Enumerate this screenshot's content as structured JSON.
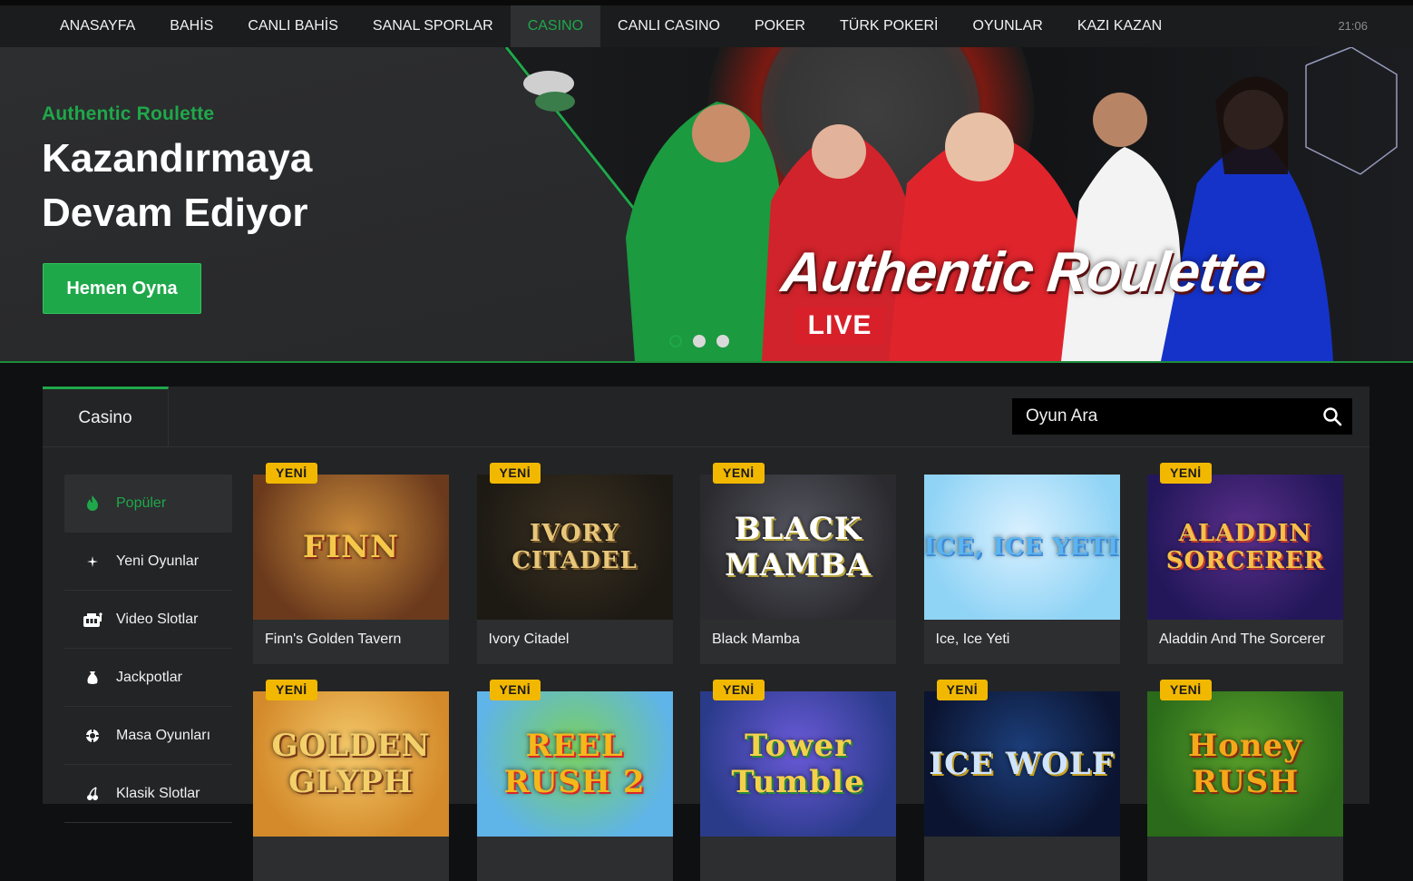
{
  "nav": {
    "items": [
      {
        "label": "ANASAYFA",
        "active": false
      },
      {
        "label": "BAHİS",
        "active": false
      },
      {
        "label": "CANLI BAHİS",
        "active": false
      },
      {
        "label": "SANAL SPORLAR",
        "active": false
      },
      {
        "label": "CASINO",
        "active": true
      },
      {
        "label": "CANLI CASINO",
        "active": false
      },
      {
        "label": "POKER",
        "active": false
      },
      {
        "label": "TÜRK POKERİ",
        "active": false
      },
      {
        "label": "OYUNLAR",
        "active": false
      },
      {
        "label": "KAZI KAZAN",
        "active": false
      }
    ],
    "clock": "21:06"
  },
  "hero": {
    "subtitle": "Authentic Roulette",
    "title": "Kazandırmaya Devam Ediyor",
    "cta": "Hemen Oyna",
    "overlay_title": "Authentic Roulette",
    "overlay_badge": "LIVE",
    "slides": 3,
    "active_slide": 0
  },
  "panel": {
    "tab_label": "Casino",
    "search_placeholder": "Oyun Ara"
  },
  "sidebar": {
    "items": [
      {
        "label": "Popüler",
        "icon": "flame-icon",
        "active": true
      },
      {
        "label": "Yeni Oyunlar",
        "icon": "sparkle-icon",
        "active": false
      },
      {
        "label": "Video Slotlar",
        "icon": "slot-machine-icon",
        "active": false
      },
      {
        "label": "Jackpotlar",
        "icon": "money-bag-icon",
        "active": false
      },
      {
        "label": "Masa Oyunları",
        "icon": "chip-icon",
        "active": false
      },
      {
        "label": "Klasik Slotlar",
        "icon": "cherry-icon",
        "active": false
      }
    ]
  },
  "games": {
    "badge_label": "YENİ",
    "rows": [
      [
        {
          "name": "Finn's Golden Tavern",
          "logo": "FINN",
          "new": true
        },
        {
          "name": "Ivory Citadel",
          "logo": "IVORY CITADEL",
          "new": true
        },
        {
          "name": "Black Mamba",
          "logo": "BLACK MAMBA",
          "new": true
        },
        {
          "name": "Ice, Ice Yeti",
          "logo": "ICE, ICE YETI",
          "new": false
        },
        {
          "name": "Aladdin And The Sorcerer",
          "logo": "ALADDIN SORCERER",
          "new": true
        }
      ],
      [
        {
          "name": "",
          "logo": "GOLDEN GLYPH",
          "new": true
        },
        {
          "name": "",
          "logo": "REEL RUSH 2",
          "new": true
        },
        {
          "name": "",
          "logo": "Tower Tumble",
          "new": true
        },
        {
          "name": "",
          "logo": "ICE WOLF",
          "new": true
        },
        {
          "name": "",
          "logo": "Honey RUSH",
          "new": true
        }
      ]
    ]
  },
  "colors": {
    "accent": "#1fa84a",
    "badge": "#f2b800",
    "nav_bg": "#1b1c1d",
    "panel_bg": "#232425",
    "live": "#d8202a"
  }
}
